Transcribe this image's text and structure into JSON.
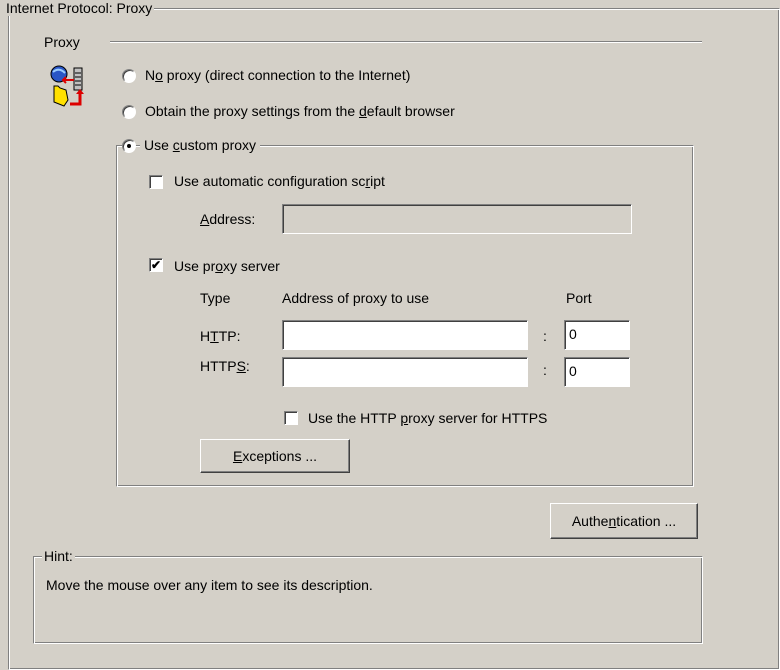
{
  "window": {
    "title": "Internet Protocol: Proxy"
  },
  "proxy": {
    "section_label": "Proxy",
    "icon": "proxy-settings-icon",
    "options": [
      {
        "pre": "N",
        "ul": "o",
        "post": " proxy (direct connection to the Internet)",
        "checked": false
      },
      {
        "pre": "Obtain the proxy settings from the ",
        "ul": "d",
        "post": "efault browser",
        "checked": false
      },
      {
        "pre": "Use ",
        "ul": "c",
        "post": "ustom proxy",
        "checked": true
      }
    ]
  },
  "custom": {
    "auto_script": {
      "pre": "Use automatic configuration sc",
      "ul": "r",
      "post": "ipt",
      "checked": false
    },
    "address": {
      "ul": "A",
      "post": "ddress:",
      "value": ""
    },
    "use_server": {
      "pre": "Use pr",
      "ul": "o",
      "post": "xy server",
      "checked": true,
      "check_glyph": "✔"
    },
    "headers": {
      "type": "Type",
      "address": "Address of proxy to use",
      "port": "Port"
    },
    "rows": [
      {
        "pre": "H",
        "ul": "T",
        "post": "TP:",
        "address": "",
        "port": "0",
        "sep": ":"
      },
      {
        "pre": "HTTP",
        "ul": "S",
        "post": ":",
        "address": "",
        "port": "0",
        "sep": ":"
      }
    ],
    "https_same": {
      "pre": "Use the HTTP ",
      "ul": "p",
      "post": "roxy server for HTTPS",
      "checked": false
    },
    "exceptions": {
      "ul": "E",
      "post": "xceptions ..."
    }
  },
  "authentication": {
    "pre": "Authe",
    "ul": "n",
    "post": "tication ..."
  },
  "hint": {
    "label": "Hint:",
    "text": "Move the mouse over any item to see its description."
  }
}
